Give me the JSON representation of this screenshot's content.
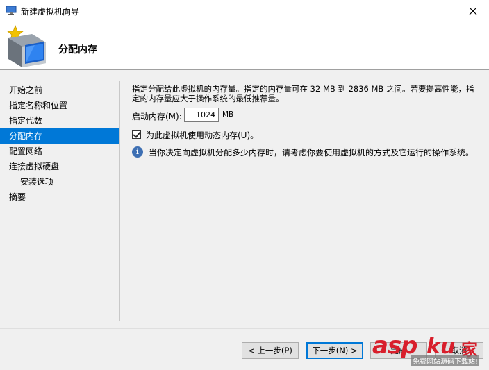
{
  "window": {
    "title": "新建虚拟机向导",
    "heading": "分配内存"
  },
  "sidebar": {
    "items": [
      {
        "label": "开始之前",
        "active": false
      },
      {
        "label": "指定名称和位置",
        "active": false
      },
      {
        "label": "指定代数",
        "active": false
      },
      {
        "label": "分配内存",
        "active": true
      },
      {
        "label": "配置网络",
        "active": false
      },
      {
        "label": "连接虚拟硬盘",
        "active": false
      },
      {
        "label": "安装选项",
        "active": false
      },
      {
        "label": "摘要",
        "active": false
      }
    ]
  },
  "main": {
    "description": "指定分配给此虚拟机的内存量。指定的内存量可在 32 MB 到 2836 MB 之间。若要提高性能，指定的内存量应大于操作系统的最低推荐量。",
    "startup_memory_label": "启动内存(M):",
    "startup_memory_value": "1024",
    "memory_unit": "MB",
    "dynamic_memory_label": "为此虚拟机使用动态内存(U)。",
    "dynamic_memory_checked": true,
    "info_text": "当你决定向虚拟机分配多少内存时，请考虑你要使用虚拟机的方式及它运行的操作系统。"
  },
  "buttons": {
    "previous": "< 上一步(P)",
    "next": "下一步(N) >",
    "finish": "完成",
    "cancel": "取消"
  },
  "watermark": {
    "brand": "asp",
    "ku": "ku",
    "jia": "家",
    "tagline": "免费网站源码下载站!"
  },
  "colors": {
    "accent": "#0078d7",
    "panel": "#f0f0f0",
    "watermark": "#d81e2b"
  }
}
